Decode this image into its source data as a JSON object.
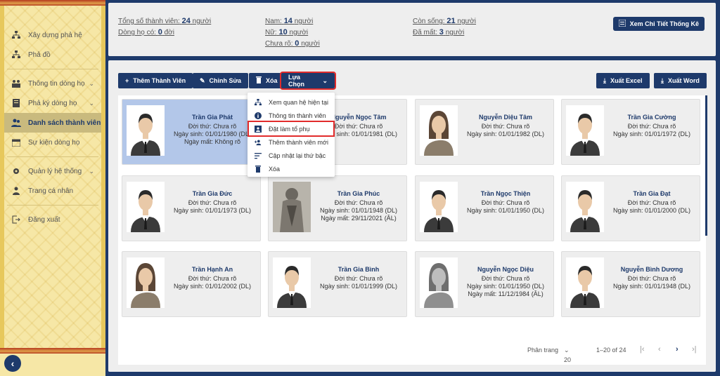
{
  "sidebar": {
    "items": [
      {
        "label": "Xây dựng phả hệ",
        "icon": "tree-icon"
      },
      {
        "label": "Phả đồ",
        "icon": "tree-icon"
      },
      {
        "label": "Thông tin dòng họ",
        "icon": "people-icon"
      },
      {
        "label": "Phả ký dòng họ",
        "icon": "book-icon"
      },
      {
        "label": "Danh sách thành viên",
        "icon": "users-icon"
      },
      {
        "label": "Sự kiện dòng họ",
        "icon": "calendar-icon"
      },
      {
        "label": "Quản lý hệ thống",
        "icon": "gear-icon"
      },
      {
        "label": "Trang cá nhân",
        "icon": "person-icon"
      },
      {
        "label": "Đăng xuất",
        "icon": "logout-icon"
      }
    ]
  },
  "stats": {
    "total_label": "Tổng số thành viên:",
    "total_value": "24",
    "total_unit": "người",
    "gen_label": "Dòng họ có:",
    "gen_value": "0",
    "gen_unit": "đời",
    "male_label": "Nam:",
    "male_value": "14",
    "male_unit": "người",
    "female_label": "Nữ:",
    "female_value": "10",
    "female_unit": "người",
    "unknown_label": "Chưa rõ:",
    "unknown_value": "0",
    "unknown_unit": "người",
    "alive_label": "Còn sống:",
    "alive_value": "21",
    "alive_unit": "người",
    "dead_label": "Đã mất:",
    "dead_value": "3",
    "dead_unit": "người",
    "detail_button": "Xem Chi Tiết Thống Kê"
  },
  "toolbar": {
    "add": "Thêm Thành Viên",
    "edit": "Chỉnh Sửa",
    "delete": "Xóa",
    "options": "Lựa Chọn",
    "export_excel": "Xuất Excel",
    "export_word": "Xuất Word"
  },
  "menu": [
    "Xem quan hệ hiện tại",
    "Thông tin thành viên",
    "Đặt làm tổ phụ",
    "Thêm thành viên mới",
    "Cập nhật lại thứ bậc",
    "Xóa"
  ],
  "members": [
    {
      "name": "Trần Gia Phát",
      "gen": "Đời thứ: Chưa rõ",
      "birth": "Ngày sinh: 01/01/1980 (DL)",
      "death": "Ngày mất: Không rõ",
      "gender": "male"
    },
    {
      "name": "Nguyễn Ngọc Tâm",
      "gen": "Đời thứ: Chưa rõ",
      "birth": "Ngày sinh: 01/01/1981 (DL)",
      "death": "",
      "gender": "female"
    },
    {
      "name": "Nguyễn Diệu Tâm",
      "gen": "Đời thứ: Chưa rõ",
      "birth": "Ngày sinh: 01/01/1982 (DL)",
      "death": "",
      "gender": "female"
    },
    {
      "name": "Trần Gia Cường",
      "gen": "Đời thứ: Chưa rõ",
      "birth": "Ngày sinh: 01/01/1972 (DL)",
      "death": "",
      "gender": "male"
    },
    {
      "name": "Trần Gia Đức",
      "gen": "Đời thứ: Chưa rõ",
      "birth": "Ngày sinh: 01/01/1973 (DL)",
      "death": "",
      "gender": "male"
    },
    {
      "name": "Trần Gia Phúc",
      "gen": "Đời thứ: Chưa rõ",
      "birth": "Ngày sinh: 01/01/1948 (DL)",
      "death": "Ngày mất: 29/11/2021 (ÂL)",
      "gender": "statue"
    },
    {
      "name": "Trần Ngọc Thiện",
      "gen": "Đời thứ: Chưa rõ",
      "birth": "Ngày sinh: 01/01/1950 (DL)",
      "death": "",
      "gender": "male"
    },
    {
      "name": "Trần Gia Đạt",
      "gen": "Đời thứ: Chưa rõ",
      "birth": "Ngày sinh: 01/01/2000 (DL)",
      "death": "",
      "gender": "male"
    },
    {
      "name": "Trần Hạnh An",
      "gen": "Đời thứ: Chưa rõ",
      "birth": "Ngày sinh: 01/01/2002 (DL)",
      "death": "",
      "gender": "female"
    },
    {
      "name": "Trần Gia Bình",
      "gen": "Đời thứ: Chưa rõ",
      "birth": "Ngày sinh: 01/01/1999 (DL)",
      "death": "",
      "gender": "male"
    },
    {
      "name": "Nguyễn Ngọc Diệu",
      "gen": "Đời thứ: Chưa rõ",
      "birth": "Ngày sinh: 01/01/1950 (DL)",
      "death": "Ngày mất: 11/12/1984 (ÂL)",
      "gender": "female-grey"
    },
    {
      "name": "Nguyễn Bình Dương",
      "gen": "Đời thứ: Chưa rõ",
      "birth": "Ngày sinh: 01/01/1948 (DL)",
      "death": "",
      "gender": "male"
    }
  ],
  "pager": {
    "label": "Phân trang",
    "page_size": "20",
    "range": "1–20 of 24"
  },
  "colors": {
    "navy": "#1e3a6b",
    "highlight_red": "#e12b2b",
    "selected_card": "#b3c7e9"
  }
}
